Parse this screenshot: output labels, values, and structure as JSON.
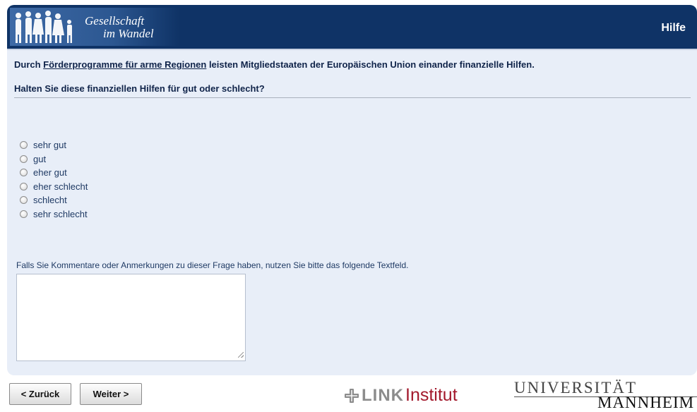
{
  "header": {
    "logo_line1": "Gesellschaft",
    "logo_line2": "im Wandel",
    "help_label": "Hilfe"
  },
  "intro": {
    "prefix": "Durch ",
    "link_text": "Förderprogramme für arme Regionen",
    "suffix": " leisten Mitgliedstaaten der Europäischen Union einander finanzielle Hilfen."
  },
  "question": "Halten Sie diese finanziellen Hilfen für gut oder schlecht?",
  "options": [
    "sehr gut",
    "gut",
    "eher gut",
    "eher schlecht",
    "schlecht",
    "sehr schlecht"
  ],
  "comment": {
    "label": "Falls Sie Kommentare oder Anmerkungen zu dieser Frage haben, nutzen Sie bitte das folgende Textfeld.",
    "value": ""
  },
  "nav": {
    "back_label": "< Zurück",
    "next_label": "Weiter >"
  },
  "footer": {
    "link_word": "LINK",
    "link_institut": "Institut",
    "uni_line1": "UNIVERSITÄT",
    "uni_line2": "MANNHEIM"
  },
  "colors": {
    "header_bg": "#0f3366",
    "panel_bg": "#e8eef8",
    "text": "#10244a",
    "link_red": "#a3192c"
  }
}
